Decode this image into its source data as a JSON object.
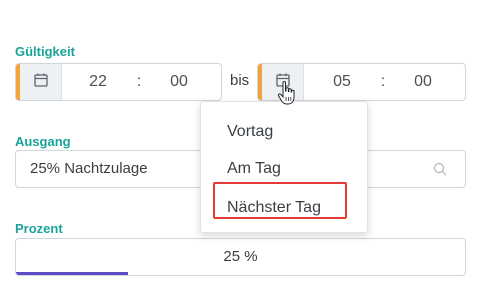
{
  "gueltigkeit": {
    "label": "Gültigkeit",
    "from": {
      "hour": "22",
      "separator": ":",
      "minute": "00"
    },
    "connector": "bis",
    "to": {
      "hour": "05",
      "separator": ":",
      "minute": "00"
    }
  },
  "ausgang": {
    "label": "Ausgang",
    "value": "25% Nachtzulage"
  },
  "prozent": {
    "label": "Prozent",
    "value": "25 %",
    "progress_percent": 25
  },
  "day_dropdown": {
    "options": [
      "Vortag",
      "Am Tag",
      "Nächster Tag"
    ],
    "highlighted": "Nächster Tag"
  },
  "colors": {
    "label_accent": "#1aa39a",
    "field_accent": "#f2a33a",
    "progress": "#5a4bc4",
    "highlight_border": "#e53935"
  },
  "icons": [
    "calendar-icon",
    "search-icon",
    "hand-cursor-icon"
  ]
}
